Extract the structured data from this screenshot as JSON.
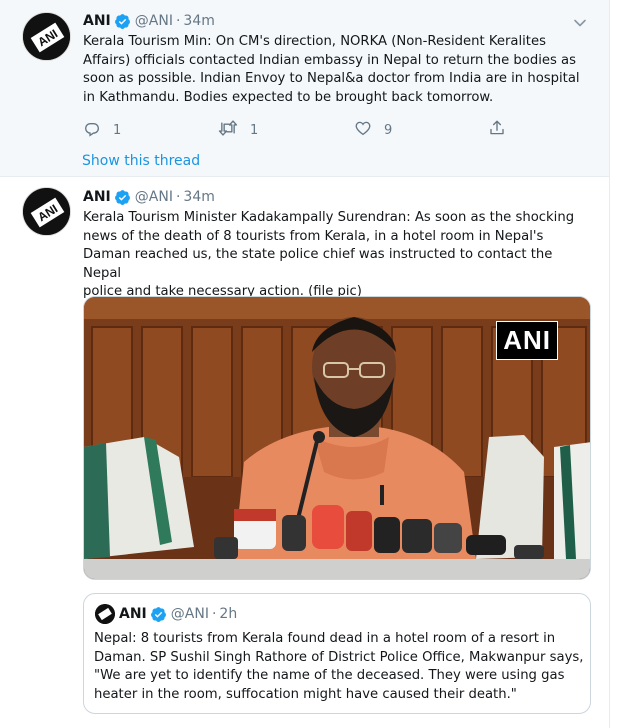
{
  "tweet1": {
    "author_name": "ANI",
    "handle": "@ANI",
    "separator": "·",
    "time": "34m",
    "text": "Kerala Tourism Min: On CM's direction, NORKA (Non-Resident Keralites\nAffairs) officials contacted Indian embassy in Nepal to return the bodies as\nsoon as possible. Indian Envoy to Nepal&a doctor from India are in hospital\nin Kathmandu. Bodies expected to be brought back tomorrow.",
    "reply_count": "1",
    "retweet_count": "1",
    "like_count": "9",
    "show_thread": "Show this thread"
  },
  "tweet2": {
    "author_name": "ANI",
    "handle": "@ANI",
    "separator": "·",
    "time": "34m",
    "text": "Kerala Tourism Minister Kadakampally Surendran: As soon as the shocking\nnews of the death of 8 tourists from Kerala, in a hotel room in Nepal's\nDaman reached us, the state police chief was instructed to contact the Nepal\npolice and take necessary action. (file pic)",
    "media_watermark": "ANI",
    "quote": {
      "author_name": "ANI",
      "handle": "@ANI",
      "separator": "·",
      "time": "2h",
      "text": "Nepal: 8 tourists from Kerala found dead in a hotel room of a resort in\nDaman. SP Sushil Singh Rathore of District Police Office, Makwanpur says,\n\"We are yet to identify the name of the deceased. They were using gas\nheater in the room, suffocation might have caused their death.\""
    }
  },
  "colors": {
    "link_blue": "#1b95e0",
    "verified_blue": "#1da1f2",
    "secondary_text": "#657786",
    "border": "#e6ecf0"
  },
  "icons": [
    "reply-icon",
    "retweet-icon",
    "like-icon",
    "share-icon",
    "chevron-down-icon",
    "verified-badge-icon"
  ]
}
